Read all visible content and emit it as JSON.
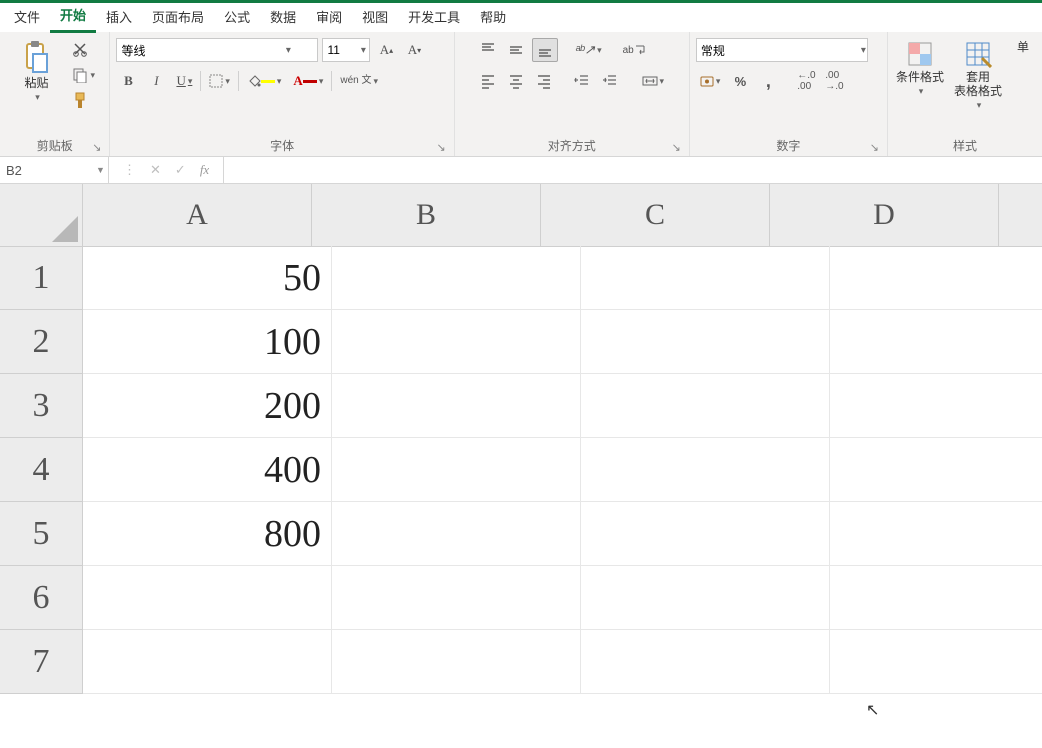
{
  "menu": [
    "文件",
    "开始",
    "插入",
    "页面布局",
    "公式",
    "数据",
    "审阅",
    "视图",
    "开发工具",
    "帮助"
  ],
  "active_menu_index": 1,
  "ribbon": {
    "clipboard": {
      "paste": "粘贴",
      "label": "剪贴板"
    },
    "font": {
      "font_name": "等线",
      "font_size": "11",
      "bold": "B",
      "italic": "I",
      "underline": "U",
      "wen": "wén 文",
      "label": "字体"
    },
    "alignment": {
      "label": "对齐方式",
      "wrap": "ab"
    },
    "number": {
      "format": "常规",
      "label": "数字"
    },
    "styles": {
      "cond": "条件格式",
      "table": "套用\n表格格式",
      "label": "样式",
      "extra": "单"
    }
  },
  "namebox": "B2",
  "formula": "",
  "columns": [
    "A",
    "B",
    "C",
    "D"
  ],
  "rows": [
    "1",
    "2",
    "3",
    "4",
    "5",
    "6",
    "7"
  ],
  "cells": {
    "A1": "50",
    "A2": "100",
    "A3": "200",
    "A4": "400",
    "A5": "800"
  }
}
